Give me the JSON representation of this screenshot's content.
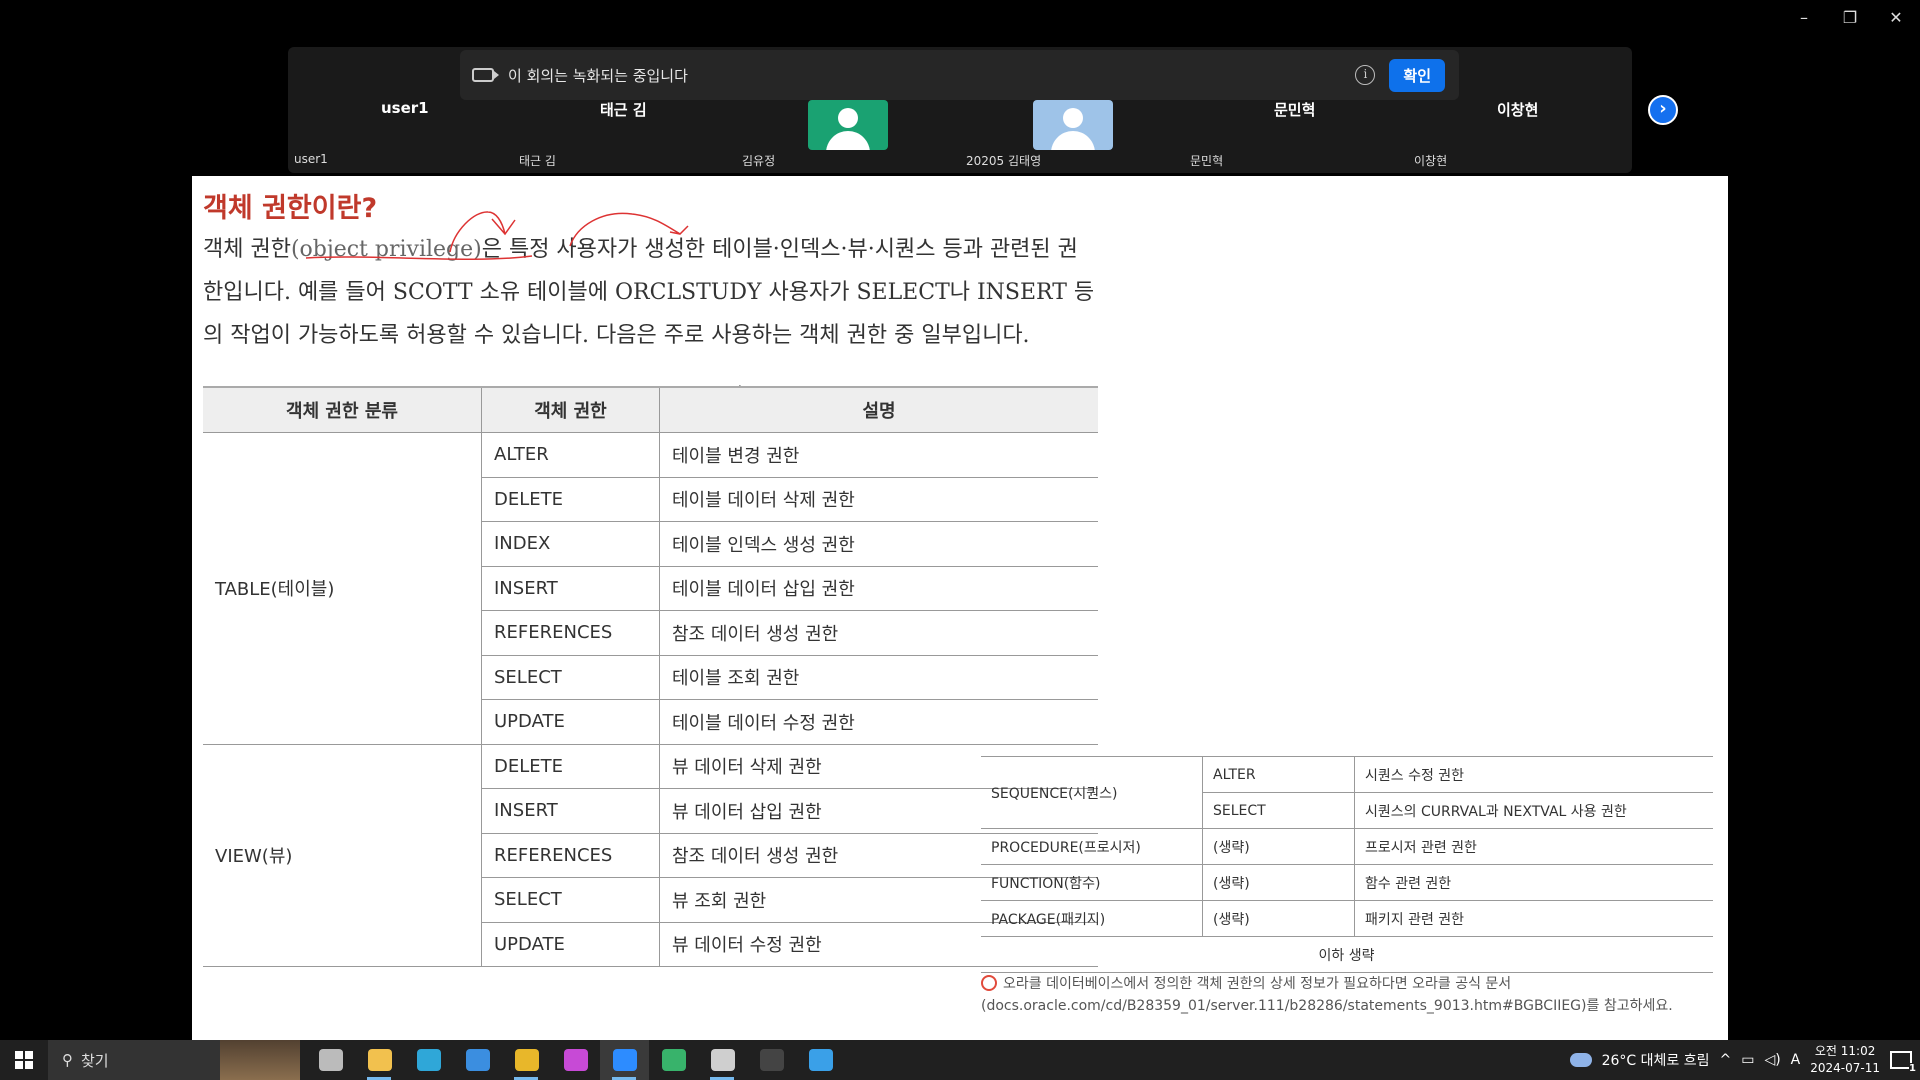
{
  "window_controls": [
    "–",
    "❐",
    "✕"
  ],
  "notice": {
    "message": "이 회의는 녹화되는 중입니다",
    "confirm_label": "확인"
  },
  "participants": [
    {
      "name": "user1",
      "label": "user1"
    },
    {
      "name": "태근 김",
      "label": "태근 김"
    },
    {
      "name": "",
      "label": "김유정",
      "avatar": true,
      "avatar_color": "#1aa272"
    },
    {
      "name": "",
      "label": "20205 김태영",
      "avatar": true,
      "avatar_color": "#9ec3e8"
    },
    {
      "name": "문민혁",
      "label": "문민혁"
    },
    {
      "name": "이창현",
      "label": "이창현"
    }
  ],
  "next_icon": "chevron-right-icon",
  "content": {
    "title": "객체 권한이란?",
    "para_line1_a": "객체 권한",
    "para_line1_en": "(object privilege)",
    "para_line1_b": "은 특정 사용자가 생성한 테이블·인덱스·뷰·시퀀스 등과 관련된 권",
    "para_line2": "한입니다. 예를 들어 SCOTT 소유 테이블에 ORCLSTUDY 사용자가 SELECT나 INSERT 등",
    "para_line3": "의 작업이 가능하도록 허용할 수 있습니다. 다음은 주로 사용하는 객체 권한 중 일부입니다.",
    "table_headers": [
      "객체 권한 분류",
      "객체 권한",
      "설명"
    ],
    "table_groups": [
      {
        "category": "TABLE(테이블)",
        "rows": [
          [
            "ALTER",
            "테이블 변경 권한"
          ],
          [
            "DELETE",
            "테이블 데이터 삭제 권한"
          ],
          [
            "INDEX",
            "테이블 인덱스 생성 권한"
          ],
          [
            "INSERT",
            "테이블 데이터 삽입 권한"
          ],
          [
            "REFERENCES",
            "참조 데이터 생성 권한"
          ],
          [
            "SELECT",
            "테이블 조회 권한"
          ],
          [
            "UPDATE",
            "테이블 데이터 수정 권한"
          ]
        ]
      },
      {
        "category": "VIEW(뷰)",
        "rows": [
          [
            "DELETE",
            "뷰 데이터 삭제 권한"
          ],
          [
            "INSERT",
            "뷰 데이터 삽입 권한"
          ],
          [
            "REFERENCES",
            "참조 데이터 생성 권한"
          ],
          [
            "SELECT",
            "뷰 조회 권한"
          ],
          [
            "UPDATE",
            "뷰 데이터 수정 권한"
          ]
        ]
      }
    ],
    "table2": {
      "sequence": {
        "category": "SEQUENCE(시퀀스)",
        "rows": [
          [
            "ALTER",
            "시퀀스 수정 권한"
          ],
          [
            "SELECT",
            "시퀀스의 CURRVAL과 NEXTVAL 사용 권한"
          ]
        ]
      },
      "others": [
        [
          "PROCEDURE(프로시저)",
          "(생략)",
          "프로시저 관련 권한"
        ],
        [
          "FUNCTION(함수)",
          "(생략)",
          "함수 관련 권한"
        ],
        [
          "PACKAGE(패키지)",
          "(생략)",
          "패키지 관련 권한"
        ]
      ],
      "footer": "이하 생략"
    },
    "note": "오라클 데이터베이스에서 정의한 객체 권한의 상세 정보가 필요하다면 오라클 공식 문서(docs.oracle.com/cd/B28359_01/server.111/b28286/statements_9013.htm#BGBCIIEG)를 참고하세요."
  },
  "taskbar": {
    "search_label": "찾기",
    "apps": [
      {
        "name": "task-view-icon",
        "color": "#bbbbbb"
      },
      {
        "name": "file-explorer-icon",
        "color": "#f2c14e"
      },
      {
        "name": "edge-icon",
        "color": "#2fa7d8"
      },
      {
        "name": "store-icon",
        "color": "#3b8ee0"
      },
      {
        "name": "chrome-icon",
        "color": "#e8b72a"
      },
      {
        "name": "discord-icon",
        "color": "#c74ad6"
      },
      {
        "name": "zoom-icon",
        "color": "#2d8cff"
      },
      {
        "name": "media-icon",
        "color": "#38b36b"
      },
      {
        "name": "notepad-icon",
        "color": "#cfcfcf"
      },
      {
        "name": "terminal-icon",
        "color": "#444444"
      },
      {
        "name": "paint-icon",
        "color": "#3aa0e8"
      }
    ],
    "weather": "26°C 대체로 흐림",
    "ime": "A",
    "time": "오전 11:02",
    "date": "2024-07-11",
    "notifications": "1"
  }
}
